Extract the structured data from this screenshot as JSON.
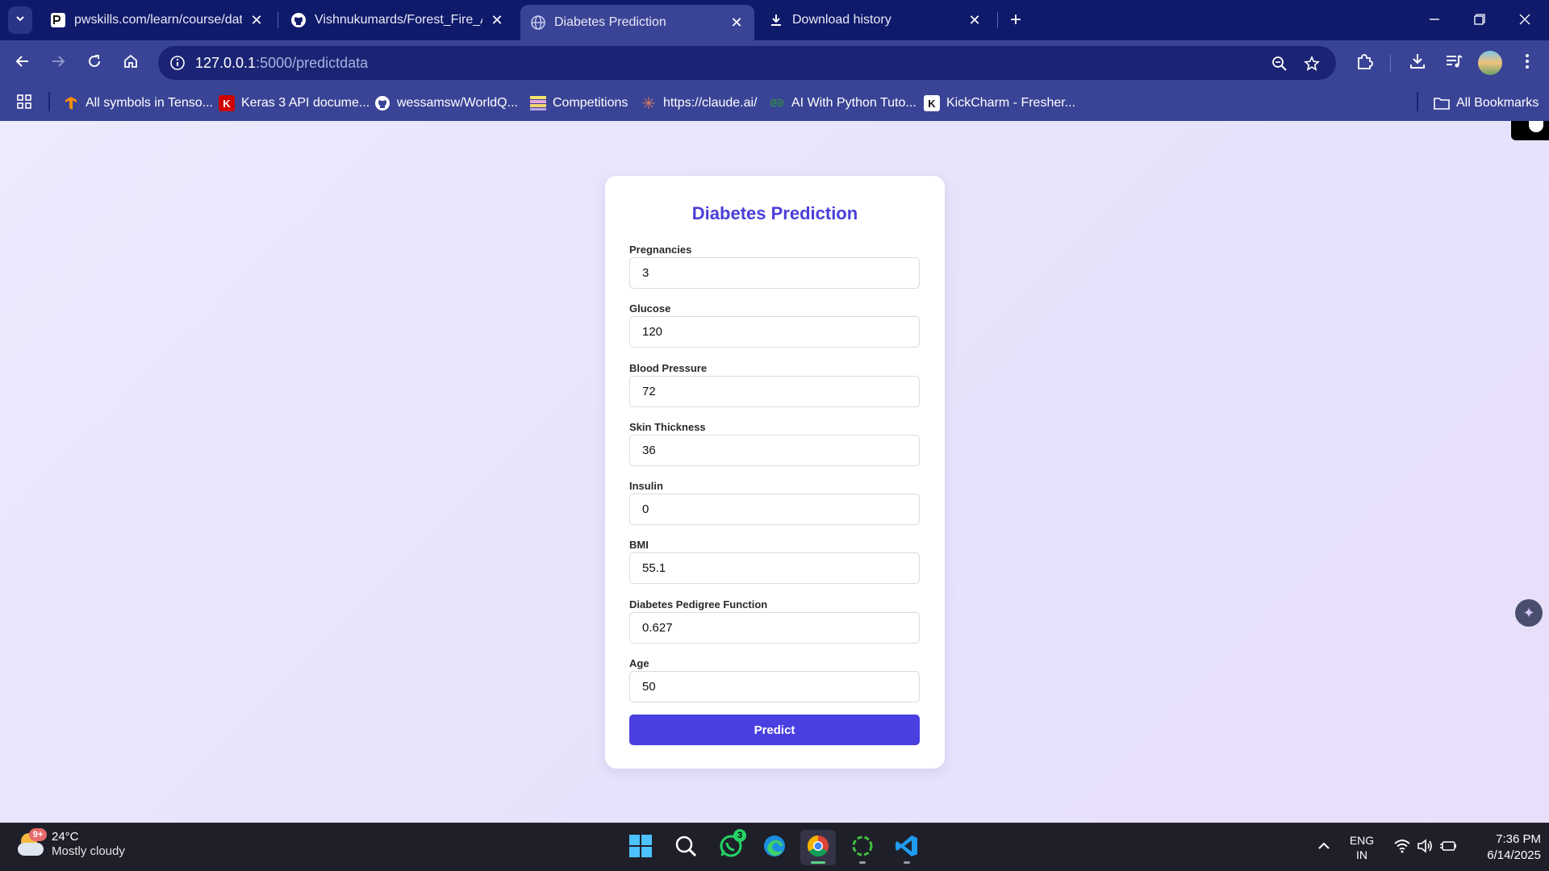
{
  "browser": {
    "tabs": [
      {
        "title": "pwskills.com/learn/course/data",
        "active": false
      },
      {
        "title": "Vishnukumards/Forest_Fire_Ana",
        "active": false
      },
      {
        "title": "Diabetes Prediction",
        "active": true
      },
      {
        "title": "Download history",
        "active": false
      }
    ],
    "url_host": "127.0.0.1",
    "url_path": ":5000/predictdata",
    "bookmarks": [
      {
        "label": "All symbols in Tenso...",
        "icon": "tensorflow-icon"
      },
      {
        "label": "Keras 3 API docume...",
        "icon": "keras-icon"
      },
      {
        "label": "wessamsw/WorldQ...",
        "icon": "github-icon"
      },
      {
        "label": "Competitions",
        "icon": "competitions-icon"
      },
      {
        "label": "https://claude.ai/",
        "icon": "claude-icon"
      },
      {
        "label": "AI With Python Tuto...",
        "icon": "geeksforgeeks-icon"
      },
      {
        "label": "KickCharm - Fresher...",
        "icon": "kickcharm-icon"
      }
    ],
    "all_bookmarks": "All Bookmarks"
  },
  "form": {
    "title": "Diabetes Prediction",
    "fields": [
      {
        "label": "Pregnancies",
        "value": "3"
      },
      {
        "label": "Glucose",
        "value": "120"
      },
      {
        "label": "Blood Pressure",
        "value": "72"
      },
      {
        "label": "Skin Thickness",
        "value": "36"
      },
      {
        "label": "Insulin",
        "value": "0"
      },
      {
        "label": "BMI",
        "value": "55.1"
      },
      {
        "label": "Diabetes Pedigree Function",
        "value": "0.627"
      },
      {
        "label": "Age",
        "value": "50"
      }
    ],
    "submit_label": "Predict"
  },
  "taskbar": {
    "weather_badge": "9+",
    "temperature": "24°C",
    "condition": "Mostly cloudy",
    "whatsapp_badge": "3",
    "lang_primary": "ENG",
    "lang_secondary": "IN",
    "time": "7:36 PM",
    "date": "6/14/2025"
  },
  "colors": {
    "accent": "#4a3fe0",
    "title": "#4a3fd9",
    "chrome_frame": "#0f1a6b",
    "chrome_toolbar": "#3a4496"
  }
}
